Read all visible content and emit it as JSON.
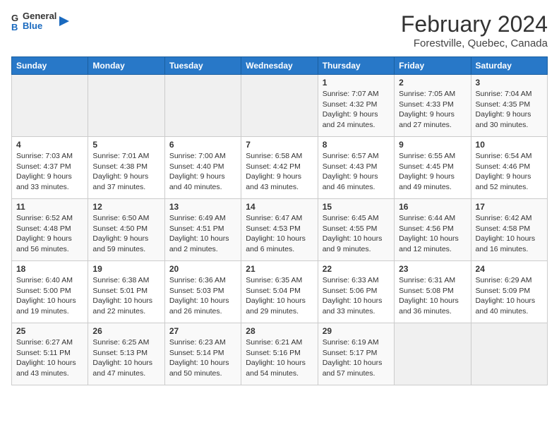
{
  "header": {
    "logo_general": "General",
    "logo_blue": "Blue",
    "month_year": "February 2024",
    "location": "Forestville, Quebec, Canada"
  },
  "weekdays": [
    "Sunday",
    "Monday",
    "Tuesday",
    "Wednesday",
    "Thursday",
    "Friday",
    "Saturday"
  ],
  "weeks": [
    [
      {
        "day": "",
        "info": ""
      },
      {
        "day": "",
        "info": ""
      },
      {
        "day": "",
        "info": ""
      },
      {
        "day": "",
        "info": ""
      },
      {
        "day": "1",
        "info": "Sunrise: 7:07 AM\nSunset: 4:32 PM\nDaylight: 9 hours\nand 24 minutes."
      },
      {
        "day": "2",
        "info": "Sunrise: 7:05 AM\nSunset: 4:33 PM\nDaylight: 9 hours\nand 27 minutes."
      },
      {
        "day": "3",
        "info": "Sunrise: 7:04 AM\nSunset: 4:35 PM\nDaylight: 9 hours\nand 30 minutes."
      }
    ],
    [
      {
        "day": "4",
        "info": "Sunrise: 7:03 AM\nSunset: 4:37 PM\nDaylight: 9 hours\nand 33 minutes."
      },
      {
        "day": "5",
        "info": "Sunrise: 7:01 AM\nSunset: 4:38 PM\nDaylight: 9 hours\nand 37 minutes."
      },
      {
        "day": "6",
        "info": "Sunrise: 7:00 AM\nSunset: 4:40 PM\nDaylight: 9 hours\nand 40 minutes."
      },
      {
        "day": "7",
        "info": "Sunrise: 6:58 AM\nSunset: 4:42 PM\nDaylight: 9 hours\nand 43 minutes."
      },
      {
        "day": "8",
        "info": "Sunrise: 6:57 AM\nSunset: 4:43 PM\nDaylight: 9 hours\nand 46 minutes."
      },
      {
        "day": "9",
        "info": "Sunrise: 6:55 AM\nSunset: 4:45 PM\nDaylight: 9 hours\nand 49 minutes."
      },
      {
        "day": "10",
        "info": "Sunrise: 6:54 AM\nSunset: 4:46 PM\nDaylight: 9 hours\nand 52 minutes."
      }
    ],
    [
      {
        "day": "11",
        "info": "Sunrise: 6:52 AM\nSunset: 4:48 PM\nDaylight: 9 hours\nand 56 minutes."
      },
      {
        "day": "12",
        "info": "Sunrise: 6:50 AM\nSunset: 4:50 PM\nDaylight: 9 hours\nand 59 minutes."
      },
      {
        "day": "13",
        "info": "Sunrise: 6:49 AM\nSunset: 4:51 PM\nDaylight: 10 hours\nand 2 minutes."
      },
      {
        "day": "14",
        "info": "Sunrise: 6:47 AM\nSunset: 4:53 PM\nDaylight: 10 hours\nand 6 minutes."
      },
      {
        "day": "15",
        "info": "Sunrise: 6:45 AM\nSunset: 4:55 PM\nDaylight: 10 hours\nand 9 minutes."
      },
      {
        "day": "16",
        "info": "Sunrise: 6:44 AM\nSunset: 4:56 PM\nDaylight: 10 hours\nand 12 minutes."
      },
      {
        "day": "17",
        "info": "Sunrise: 6:42 AM\nSunset: 4:58 PM\nDaylight: 10 hours\nand 16 minutes."
      }
    ],
    [
      {
        "day": "18",
        "info": "Sunrise: 6:40 AM\nSunset: 5:00 PM\nDaylight: 10 hours\nand 19 minutes."
      },
      {
        "day": "19",
        "info": "Sunrise: 6:38 AM\nSunset: 5:01 PM\nDaylight: 10 hours\nand 22 minutes."
      },
      {
        "day": "20",
        "info": "Sunrise: 6:36 AM\nSunset: 5:03 PM\nDaylight: 10 hours\nand 26 minutes."
      },
      {
        "day": "21",
        "info": "Sunrise: 6:35 AM\nSunset: 5:04 PM\nDaylight: 10 hours\nand 29 minutes."
      },
      {
        "day": "22",
        "info": "Sunrise: 6:33 AM\nSunset: 5:06 PM\nDaylight: 10 hours\nand 33 minutes."
      },
      {
        "day": "23",
        "info": "Sunrise: 6:31 AM\nSunset: 5:08 PM\nDaylight: 10 hours\nand 36 minutes."
      },
      {
        "day": "24",
        "info": "Sunrise: 6:29 AM\nSunset: 5:09 PM\nDaylight: 10 hours\nand 40 minutes."
      }
    ],
    [
      {
        "day": "25",
        "info": "Sunrise: 6:27 AM\nSunset: 5:11 PM\nDaylight: 10 hours\nand 43 minutes."
      },
      {
        "day": "26",
        "info": "Sunrise: 6:25 AM\nSunset: 5:13 PM\nDaylight: 10 hours\nand 47 minutes."
      },
      {
        "day": "27",
        "info": "Sunrise: 6:23 AM\nSunset: 5:14 PM\nDaylight: 10 hours\nand 50 minutes."
      },
      {
        "day": "28",
        "info": "Sunrise: 6:21 AM\nSunset: 5:16 PM\nDaylight: 10 hours\nand 54 minutes."
      },
      {
        "day": "29",
        "info": "Sunrise: 6:19 AM\nSunset: 5:17 PM\nDaylight: 10 hours\nand 57 minutes."
      },
      {
        "day": "",
        "info": ""
      },
      {
        "day": "",
        "info": ""
      }
    ]
  ]
}
